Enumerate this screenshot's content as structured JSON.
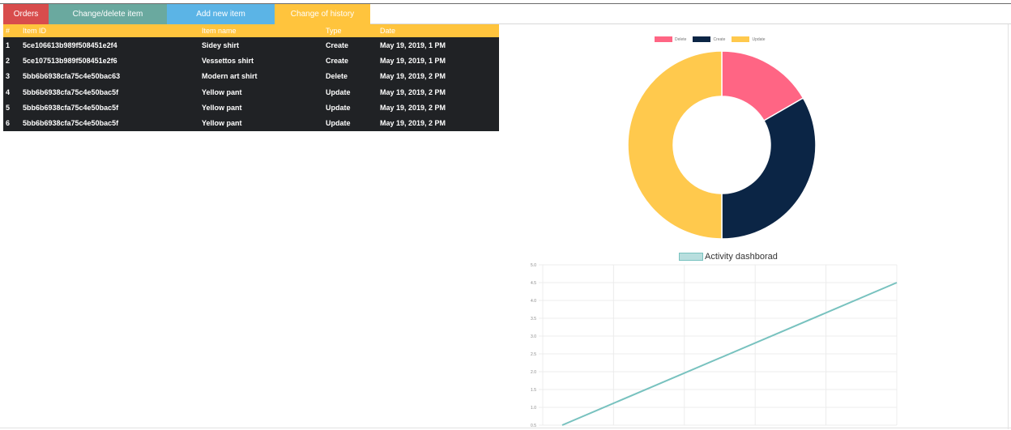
{
  "tabs": [
    {
      "label": "Orders",
      "color": "#d84c4c"
    },
    {
      "label": "Change/delete item",
      "color": "#6aa99f"
    },
    {
      "label": "Add new item",
      "color": "#5bb4e6"
    },
    {
      "label": "Change of history",
      "color": "#ffc43d"
    }
  ],
  "history_table": {
    "headers": [
      "#",
      "Item ID",
      "Item name",
      "Type",
      "Date"
    ],
    "rows": [
      [
        "1",
        "5ce106613b989f508451e2f4",
        "Sidey shirt",
        "Create",
        "May 19, 2019, 1 PM"
      ],
      [
        "2",
        "5ce107513b989f508451e2f6",
        "Vessettos shirt",
        "Create",
        "May 19, 2019, 1 PM"
      ],
      [
        "3",
        "5bb6b6938cfa75c4e50bac63",
        "Modern art shirt",
        "Delete",
        "May 19, 2019, 2 PM"
      ],
      [
        "4",
        "5bb6b6938cfa75c4e50bac5f",
        "Yellow pant",
        "Update",
        "May 19, 2019, 2 PM"
      ],
      [
        "5",
        "5bb6b6938cfa75c4e50bac5f",
        "Yellow pant",
        "Update",
        "May 19, 2019, 2 PM"
      ],
      [
        "6",
        "5bb6b6938cfa75c4e50bac5f",
        "Yellow pant",
        "Update",
        "May 19, 2019, 2 PM"
      ]
    ]
  },
  "chart_data": [
    {
      "type": "pie",
      "variant": "doughnut",
      "legend_position": "top",
      "categories": [
        "Delete",
        "Create",
        "Update"
      ],
      "values": [
        1,
        2,
        3
      ],
      "colors": [
        "#ff6584",
        "#0b2545",
        "#ffc94d"
      ]
    },
    {
      "type": "line",
      "title": "Activity dashborad",
      "series": [
        {
          "name": "",
          "x": [
            0,
            1
          ],
          "y": [
            0.5,
            4.5
          ],
          "color": "#78c2bf"
        }
      ],
      "y_ticks": [
        "0.5",
        "1.0",
        "1.5",
        "2.0",
        "2.5",
        "3.0",
        "3.5",
        "4.0",
        "4.5",
        "5.0"
      ],
      "ylim": [
        0.5,
        5.0
      ],
      "grid": true
    }
  ]
}
